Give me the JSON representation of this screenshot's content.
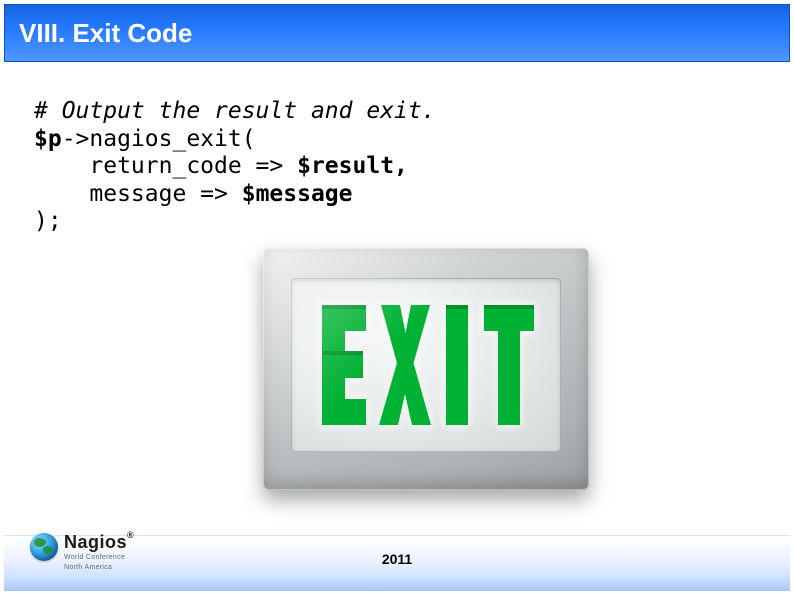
{
  "title": "VIII. Exit Code",
  "code": {
    "comment": "# Output the result and exit.",
    "var_p": "$p",
    "arrow_call": "->nagios_exit(",
    "indent": "    ",
    "line2_pre": "return_code => ",
    "result_var": "$result",
    "comma": ",",
    "line3_pre": "message => ",
    "message_var": "$message",
    "close": ");"
  },
  "exit_sign": {
    "letters": [
      "E",
      "X",
      "I",
      "T"
    ],
    "letter_color": "#00b233",
    "case_color": "#c9cccd"
  },
  "footer": {
    "year": "2011"
  },
  "logo": {
    "main": "Nagios",
    "reg": "®",
    "sub_line1": "World Conference",
    "sub_line2": "North America"
  }
}
